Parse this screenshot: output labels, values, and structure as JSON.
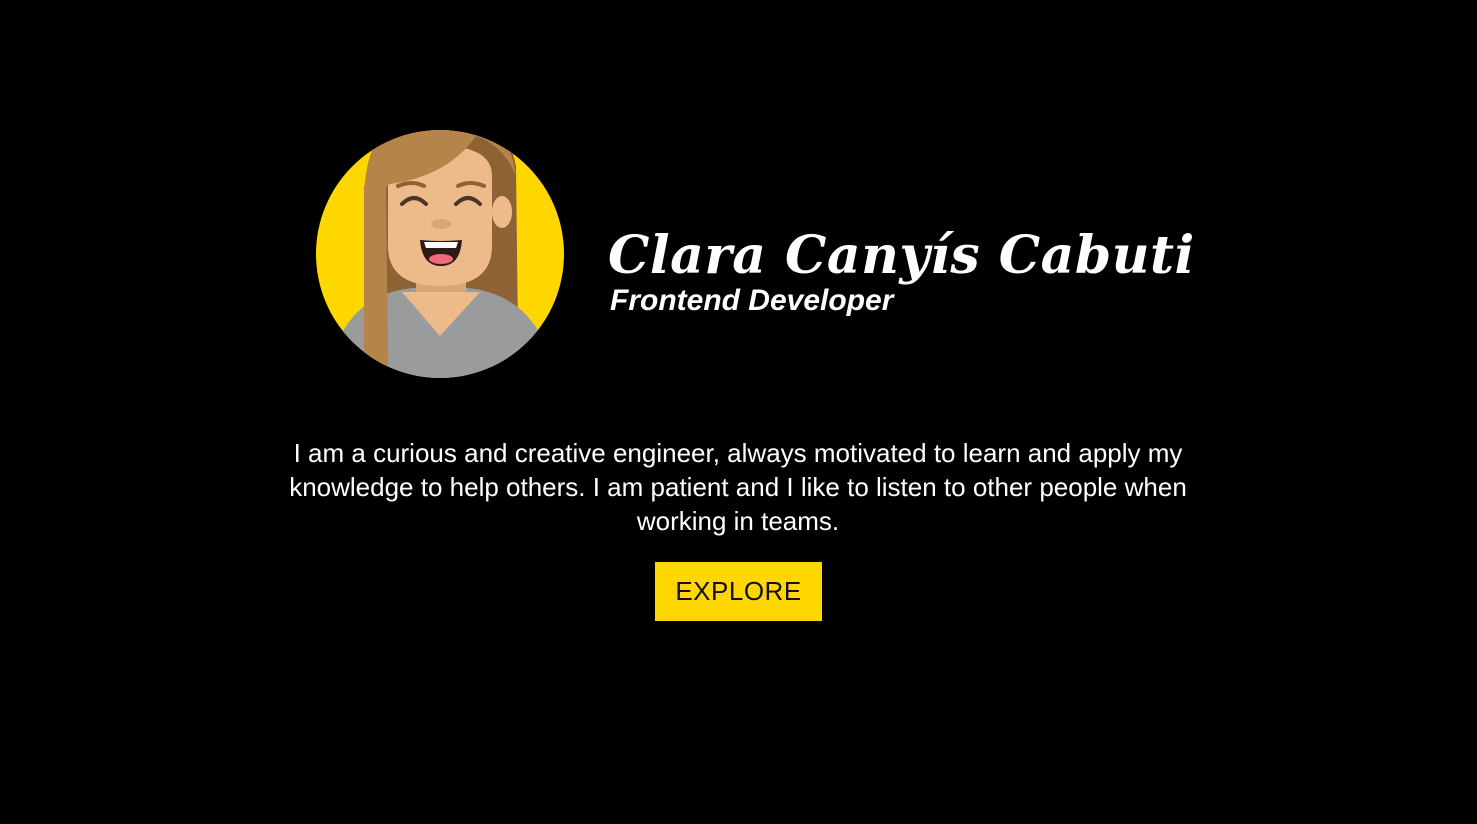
{
  "profile": {
    "name": "Clara Canyís Cabuti",
    "role": "Frontend Developer",
    "bio": "I am a curious and creative engineer, always motivated to learn and apply my knowledge to help others. I am patient and I like to listen to other people when working in teams.",
    "avatar_icon": "woman-avatar-icon"
  },
  "cta": {
    "label": "EXPLORE"
  },
  "colors": {
    "background": "#000000",
    "accent": "#ffd700",
    "text": "#ffffff",
    "hair": "#b5844a",
    "skin": "#edbb8a",
    "shirt": "#9a9b9c"
  }
}
